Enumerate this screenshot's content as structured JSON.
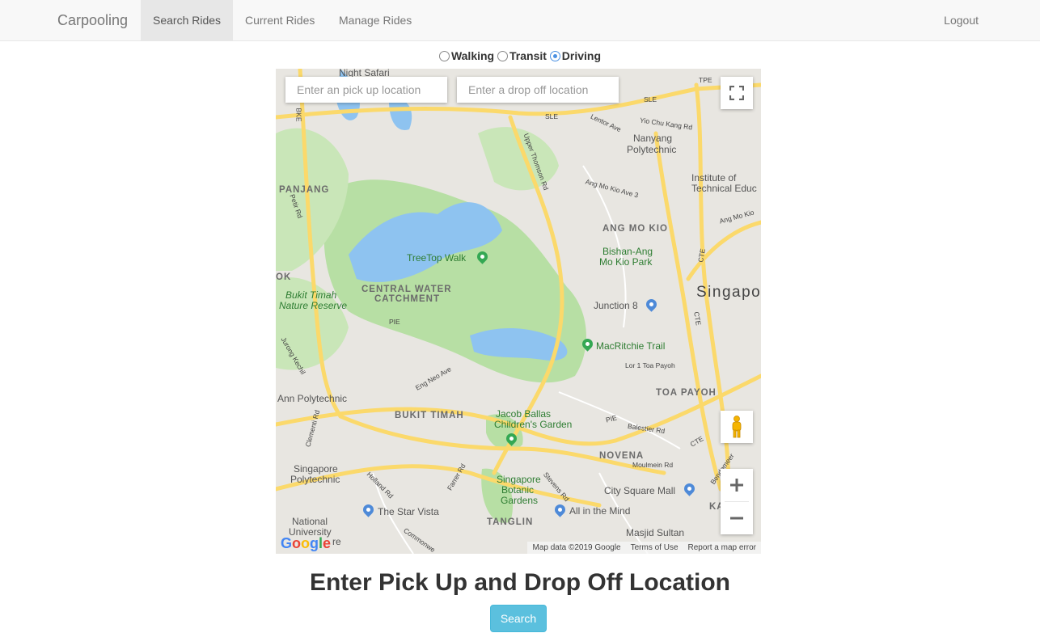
{
  "navbar": {
    "brand": "Carpooling",
    "items": [
      {
        "label": "Search Rides",
        "active": true
      },
      {
        "label": "Current Rides",
        "active": false
      },
      {
        "label": "Manage Rides",
        "active": false
      }
    ],
    "logout": "Logout"
  },
  "travel_modes": {
    "options": [
      "Walking",
      "Transit",
      "Driving"
    ],
    "selected": "Driving"
  },
  "map": {
    "pickup_placeholder": "Enter an pick up location",
    "dropoff_placeholder": "Enter a drop off location",
    "labels": {
      "night_safari": "Night Safari",
      "sle_1": "SLE",
      "sle_2": "SLE",
      "tpe": "TPE",
      "lentor": "Lentor Ave",
      "yio_chu_kang": "Yio Chu Kang Rd",
      "nanyang_1": "Nanyang",
      "nanyang_2": "Polytechnic",
      "upper_thomson": "Upper Thomson Rd",
      "institute_1": "Institute of",
      "institute_2": "Technical Educ",
      "amk_ave3": "Ang Mo Kio Ave 3",
      "amk_ave_e": "Ang Mo Kio",
      "bke": "BKE",
      "panjang": "PANJANG",
      "petir": "Petir Rd",
      "ang_mo_kio": "ANG MO KIO",
      "bishan_1": "Bishan-Ang",
      "bishan_2": "Mo Kio Park",
      "treetop": "TreeTop Walk",
      "ok": "OK",
      "cwc_1": "CENTRAL WATER",
      "cwc_2": "CATCHMENT",
      "bukit_timah_nr_1": "Bukit Timah",
      "bukit_timah_nr_2": "Nature Reserve",
      "singapore": "Singapo",
      "cte_1": "CTE",
      "cte_2": "CTE",
      "cte_3": "CTE",
      "junction8": "Junction 8",
      "pie_1": "PIE",
      "pie_2": "PIE",
      "macritchie": "MacRitchie Trail",
      "toh_payoh_rd": "Lor 1 Toa Payoh",
      "jurong_kechil": "Jurong Kechil",
      "eng_neo": "Eng Neo Ave",
      "ngee_ann": "Ann Polytechnic",
      "toa_payoh": "TOA PAYOH",
      "bukit_timah": "BUKIT TIMAH",
      "jacob_1": "Jacob Ballas",
      "jacob_2": "Children's Garden",
      "clementi": "Clementi Rd",
      "balestier": "Balestier Rd",
      "novena": "NOVENA",
      "moulmein": "Moulmein Rd",
      "bendemeer": "Bendemeer",
      "sp_1": "Singapore",
      "sp_2": "Polytechnic",
      "farrer": "Farrer Rd",
      "holland": "Holland Rd",
      "sbg_1": "Singapore",
      "sbg_2": "Botanic",
      "sbg_3": "Gardens",
      "stevens": "Stevens Rd",
      "city_square": "City Square Mall",
      "star_vista": "The Star Vista",
      "all_in_mind": "All in the Mind",
      "kallang": "KA",
      "nus_1": "National",
      "nus_2": "University",
      "nus_3": "re",
      "commonwealth": "Commonwe",
      "tanglin": "TANGLIN",
      "masjid": "Masjid Sultan"
    },
    "google_logo": "Google",
    "attribution": {
      "data": "Map data ©2019 Google",
      "terms": "Terms of Use",
      "report": "Report a map error"
    },
    "colors": {
      "land": "#e8e6e1",
      "park": "#b7dfa4",
      "water": "#8ec3f0",
      "road": "#fbd96b"
    }
  },
  "main": {
    "heading": "Enter Pick Up and Drop Off Location",
    "search_button": "Search"
  },
  "colors": {
    "search_button": "#5bc0de",
    "navbar_bg": "#f8f8f8"
  }
}
